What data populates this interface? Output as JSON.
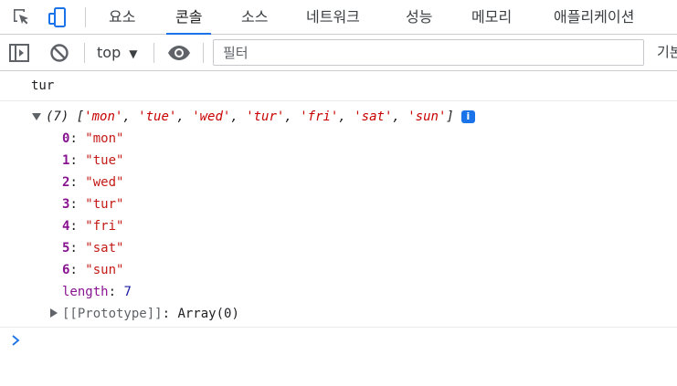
{
  "tabs": [
    "요소",
    "콘솔",
    "소스",
    "네트워크",
    "성능",
    "메모리",
    "애플리케이션"
  ],
  "toolbar": {
    "context": "top",
    "filter_placeholder": "필터",
    "levels_label": "기본"
  },
  "console": {
    "log_message": "tur",
    "array": {
      "length_prefix": "(7)",
      "preview_items": [
        "'mon'",
        "'tue'",
        "'wed'",
        "'tur'",
        "'fri'",
        "'sat'",
        "'sun'"
      ],
      "info_badge": "i",
      "entries": [
        {
          "index": "0",
          "value": "\"mon\""
        },
        {
          "index": "1",
          "value": "\"tue\""
        },
        {
          "index": "2",
          "value": "\"wed\""
        },
        {
          "index": "3",
          "value": "\"tur\""
        },
        {
          "index": "4",
          "value": "\"fri\""
        },
        {
          "index": "5",
          "value": "\"sat\""
        },
        {
          "index": "6",
          "value": "\"sun\""
        }
      ],
      "length_key": "length",
      "length_value": "7",
      "prototype_key": "[[Prototype]]",
      "prototype_value": "Array(0)"
    }
  },
  "colors": {
    "accent": "#1a73e8",
    "string": "#c41a16",
    "key": "#881391",
    "prompt": "#1a73e8"
  }
}
